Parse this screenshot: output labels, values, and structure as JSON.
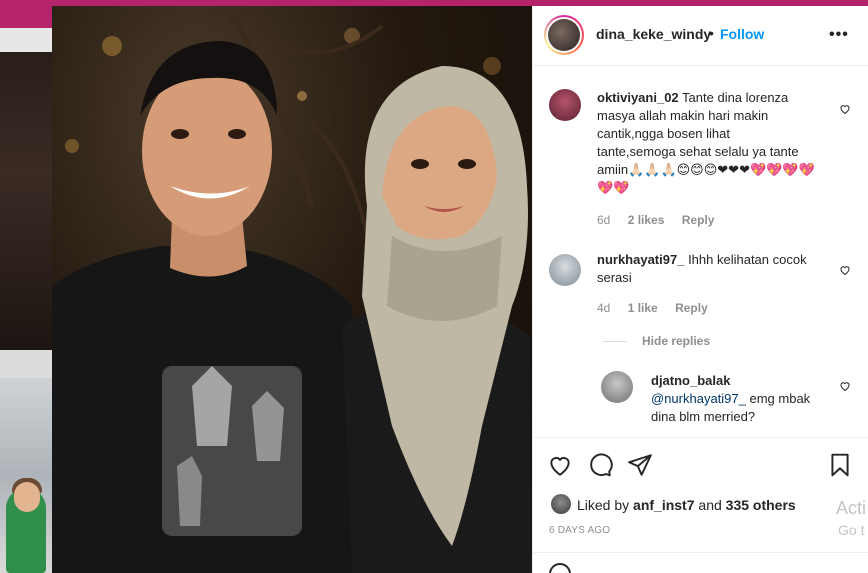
{
  "post": {
    "username": "dina_keke_windy",
    "separator": "•",
    "follow_label": "Follow",
    "more_label": "•••"
  },
  "comments": [
    {
      "username": "oktiviyani_02",
      "text_lines": [
        "Tante dina lorenza",
        "masya allah makin hari makin",
        "cantik,ngga bosen lihat",
        "tante,semoga sehat selalu ya tante",
        "amiin🙏🏻🙏🏻🙏🏻😊😊😊❤❤❤💖💖💖💖",
        "💖💖"
      ],
      "age": "6d",
      "likes": "2 likes",
      "reply_label": "Reply"
    },
    {
      "username": "nurkhayati97_",
      "text_lines": [
        "Ihhh kelihatan cocok",
        "serasi"
      ],
      "age": "4d",
      "likes": "1 like",
      "reply_label": "Reply"
    }
  ],
  "hide_replies_label": "Hide replies",
  "reply": {
    "username": "djatno_balak",
    "mention": "@nurkhayati97_",
    "text_line1": " emg mbak",
    "text_line2": "dina blm merried?"
  },
  "liked_by": {
    "prefix": "Liked by ",
    "user": "anf_inst7",
    "middle": " and ",
    "others": "335 others"
  },
  "timestamp": "6 DAYS AGO",
  "watermark": {
    "line1": "Acti",
    "line2": "Go t"
  },
  "colors": {
    "accent": "#0095f6",
    "brand_bar": "#b5246a",
    "text": "#262626",
    "muted": "#8e8e8e"
  }
}
